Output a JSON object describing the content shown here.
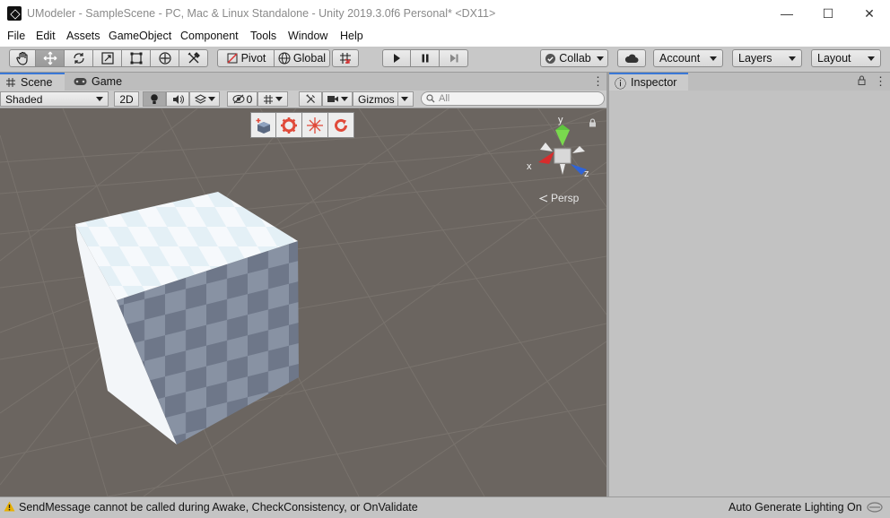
{
  "window": {
    "title": "UModeler - SampleScene - PC, Mac & Linux Standalone - Unity 2019.3.0f6 Personal* <DX11>",
    "minimize_glyph": "—",
    "maximize_glyph": "☐",
    "close_glyph": "✕"
  },
  "menu": [
    "File",
    "Edit",
    "Assets",
    "GameObject",
    "Component",
    "Tools",
    "Window",
    "Help"
  ],
  "toolbar": {
    "pivot_label": "Pivot",
    "global_label": "Global",
    "collab_label": "Collab",
    "account_label": "Account",
    "layers_label": "Layers",
    "layout_label": "Layout"
  },
  "scene": {
    "tab_scene": "Scene",
    "tab_game": "Game",
    "shading_mode": "Shaded",
    "mode_2d": "2D",
    "hidden_count": "0",
    "gizmos_label": "Gizmos",
    "search_placeholder": "All",
    "persp_label": "Persp",
    "axis_x": "x",
    "axis_y": "y",
    "axis_z": "z"
  },
  "inspector": {
    "tab_label": "Inspector"
  },
  "status": {
    "message": "SendMessage cannot be called during Awake, CheckConsistency, or OnValidate",
    "lighting": "Auto Generate Lighting On"
  },
  "colors": {
    "accent_tab": "#3a78d6",
    "scene_bg": "#6b6560",
    "umodeler_red": "#e04a3a",
    "warning_yellow": "#e8b000"
  }
}
